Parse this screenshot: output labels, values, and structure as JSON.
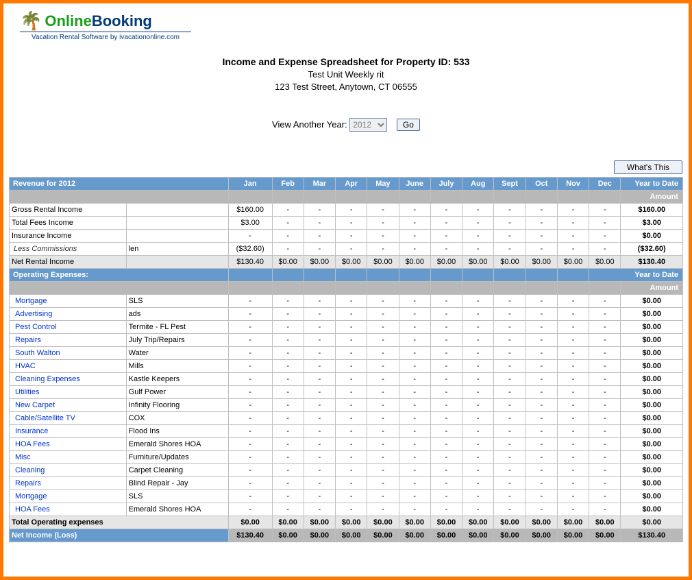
{
  "logo": {
    "online": "Online",
    "booking": "Booking",
    "tagline": "Vacation Rental Software by ivacationonline.com"
  },
  "header": {
    "title": "Income and Expense Spreadsheet for Property ID: 533",
    "unit": "Test Unit Weekly rit",
    "address": "123 Test Street, Anytown, CT 06555"
  },
  "yearSelector": {
    "label": "View Another Year:",
    "value": "2012",
    "go": "Go"
  },
  "buttons": {
    "whatsThis": "What's This"
  },
  "columns": [
    "Jan",
    "Feb",
    "Mar",
    "Apr",
    "May",
    "June",
    "July",
    "Aug",
    "Sept",
    "Oct",
    "Nov",
    "Dec"
  ],
  "revenue": {
    "sectionLabel": "Revenue for 2012",
    "ytdLabel": "Year to Date",
    "amountLabel": "Amount",
    "rows": [
      {
        "cat": "Gross Rental Income",
        "vendor": "",
        "jan": "$160.00",
        "rest": "-",
        "ytd": "$160.00",
        "type": "plain"
      },
      {
        "cat": "Total Fees Income",
        "vendor": "",
        "jan": "$3.00",
        "rest": "-",
        "ytd": "$3.00",
        "type": "plain"
      },
      {
        "cat": "Insurance Income",
        "vendor": "",
        "jan": "-",
        "rest": "-",
        "ytd": "$0.00",
        "type": "plain"
      },
      {
        "cat": "Less Commissions",
        "vendor": "len",
        "jan": "($32.60)",
        "rest": "-",
        "ytd": "($32.60)",
        "type": "italic"
      }
    ],
    "netRow": {
      "cat": "Net Rental Income",
      "jan": "$130.40",
      "rest": "$0.00",
      "ytd": "$130.40"
    }
  },
  "expenses": {
    "sectionLabel": "Operating Expenses:",
    "ytdLabel": "Year to Date",
    "amountLabel": "Amount",
    "rows": [
      {
        "cat": "Mortgage",
        "vendor": "SLS"
      },
      {
        "cat": "Advertising",
        "vendor": "ads"
      },
      {
        "cat": "Pest Control",
        "vendor": "Termite - FL Pest"
      },
      {
        "cat": "Repairs",
        "vendor": "July Trip/Repairs"
      },
      {
        "cat": "South Walton",
        "vendor": "Water"
      },
      {
        "cat": "HVAC",
        "vendor": "Mills"
      },
      {
        "cat": "Cleaning Expenses",
        "vendor": "Kastle Keepers"
      },
      {
        "cat": "Utilities",
        "vendor": "Gulf Power"
      },
      {
        "cat": "New Carpet",
        "vendor": "Infinity Flooring"
      },
      {
        "cat": "Cable/Satellite TV",
        "vendor": "COX"
      },
      {
        "cat": "Insurance",
        "vendor": "Flood Ins"
      },
      {
        "cat": "HOA Fees",
        "vendor": "Emerald Shores HOA"
      },
      {
        "cat": "Misc",
        "vendor": "Furniture/Updates"
      },
      {
        "cat": "Cleaning",
        "vendor": "Carpet Cleaning"
      },
      {
        "cat": "Repairs",
        "vendor": "Blind Repair - Jay"
      },
      {
        "cat": "Mortgage",
        "vendor": "SLS"
      },
      {
        "cat": "HOA Fees",
        "vendor": "Emerald Shores HOA"
      }
    ],
    "expenseDash": "-",
    "expenseYtd": "$0.00",
    "totalRow": {
      "cat": "Total Operating expenses",
      "val": "$0.00",
      "ytd": "$0.00"
    },
    "netIncomeRow": {
      "cat": "Net Income (Loss)",
      "jan": "$130.40",
      "rest": "$0.00",
      "ytd": "$130.40"
    }
  }
}
